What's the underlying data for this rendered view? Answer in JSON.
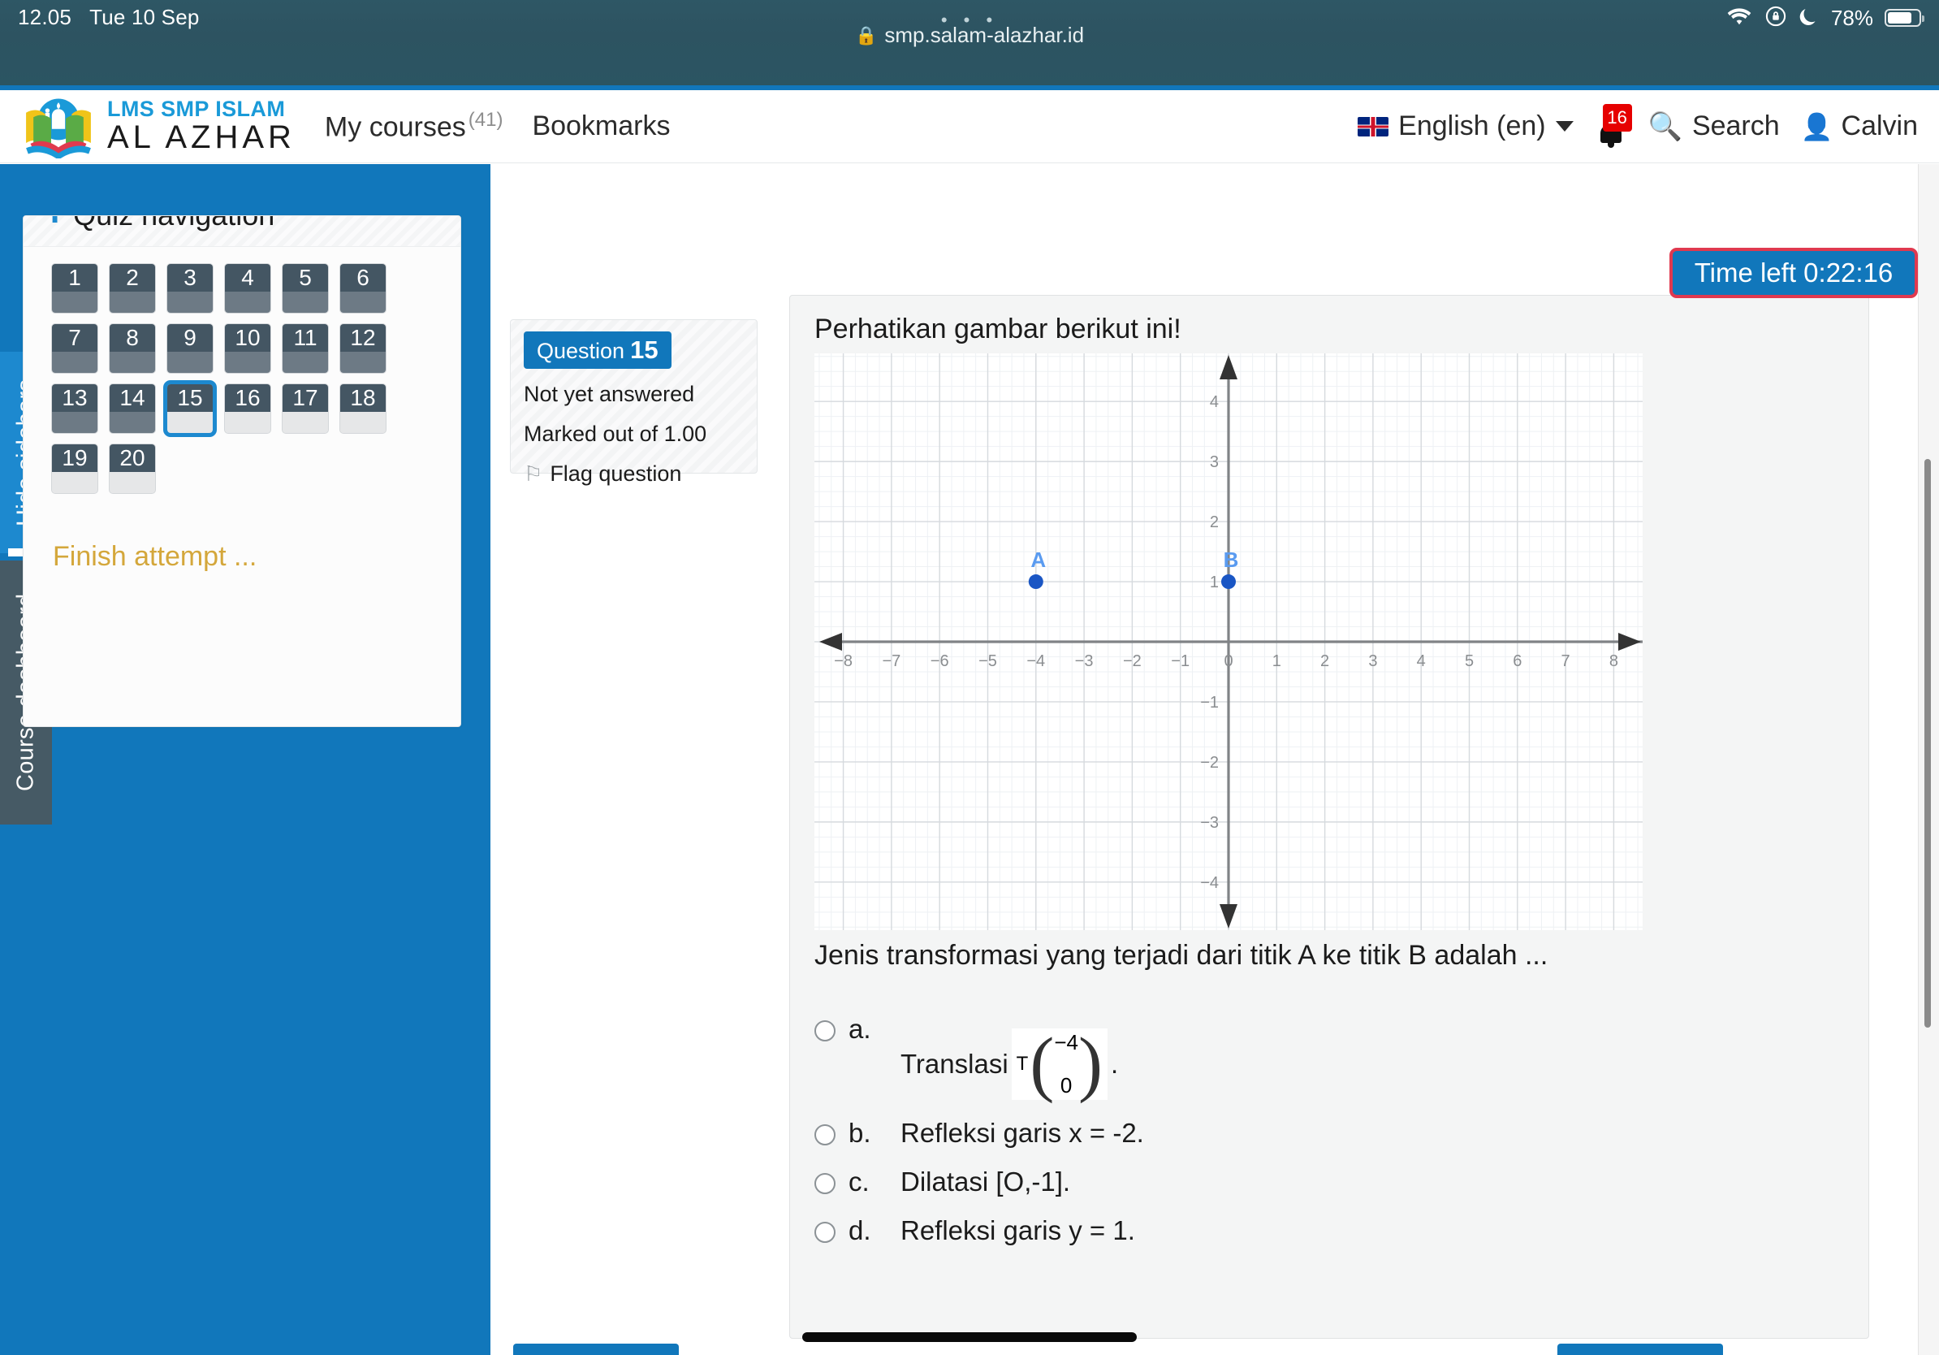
{
  "status_bar": {
    "time": "12.05",
    "date": "Tue 10 Sep",
    "battery_percent": "78%",
    "icons": [
      "wifi-icon",
      "rotation-lock-icon",
      "do-not-disturb-moon-icon",
      "battery-icon"
    ]
  },
  "browser": {
    "tab_dots": "• • •",
    "lock_icon": "🔒",
    "url": "smp.salam-alazhar.id"
  },
  "navbar": {
    "brand_top": "LMS SMP ISLAM",
    "brand_bottom": "AL AZHAR",
    "my_courses": "My courses",
    "my_courses_count": "(41)",
    "bookmarks": "Bookmarks",
    "language": "English (en)",
    "notification_count": "16",
    "search": "Search",
    "user": "Calvin"
  },
  "side_tabs": {
    "hide_sidebars": "Hide sidebars",
    "course_dashboard": "Course dashboard"
  },
  "quiz_navigation": {
    "title": "Quiz navigation",
    "questions": [
      {
        "n": "1",
        "answered": true,
        "current": false
      },
      {
        "n": "2",
        "answered": true,
        "current": false
      },
      {
        "n": "3",
        "answered": true,
        "current": false
      },
      {
        "n": "4",
        "answered": true,
        "current": false
      },
      {
        "n": "5",
        "answered": true,
        "current": false
      },
      {
        "n": "6",
        "answered": true,
        "current": false
      },
      {
        "n": "7",
        "answered": true,
        "current": false
      },
      {
        "n": "8",
        "answered": true,
        "current": false
      },
      {
        "n": "9",
        "answered": true,
        "current": false
      },
      {
        "n": "10",
        "answered": true,
        "current": false
      },
      {
        "n": "11",
        "answered": true,
        "current": false
      },
      {
        "n": "12",
        "answered": true,
        "current": false
      },
      {
        "n": "13",
        "answered": true,
        "current": false
      },
      {
        "n": "14",
        "answered": true,
        "current": false
      },
      {
        "n": "15",
        "answered": false,
        "current": true
      },
      {
        "n": "16",
        "answered": false,
        "current": false
      },
      {
        "n": "17",
        "answered": false,
        "current": false
      },
      {
        "n": "18",
        "answered": false,
        "current": false
      },
      {
        "n": "19",
        "answered": false,
        "current": false
      },
      {
        "n": "20",
        "answered": false,
        "current": false
      }
    ],
    "finish_attempt": "Finish attempt ..."
  },
  "question_meta": {
    "label": "Question",
    "number": "15",
    "state": "Not yet answered",
    "marks": "Marked out of 1.00",
    "flag": "Flag question"
  },
  "timer": {
    "label": "Time left 0:22:16"
  },
  "question": {
    "prompt": "Perhatikan gambar berikut ini!",
    "sub_prompt": "Jenis transformasi yang terjadi dari titik A ke titik B adalah ...",
    "answers": [
      {
        "letter": "a.",
        "text": "Translasi",
        "has_matrix": true,
        "matrix_symbol": "T",
        "matrix_top": "−4",
        "matrix_bottom": "0",
        "trailing": "."
      },
      {
        "letter": "b.",
        "text": "Refleksi garis x = -2.",
        "has_matrix": false
      },
      {
        "letter": "c.",
        "text": "Dilatasi [O,-1].",
        "has_matrix": false
      },
      {
        "letter": "d.",
        "text": "Refleksi garis y = 1.",
        "has_matrix": false
      }
    ]
  },
  "chart_data": {
    "type": "scatter",
    "title": "",
    "xlabel": "",
    "ylabel": "",
    "xlim": [
      -8.6,
      8.6
    ],
    "ylim": [
      -4.8,
      4.8
    ],
    "xticks": [
      -8,
      -7,
      -6,
      -5,
      -4,
      -3,
      -2,
      -1,
      0,
      1,
      2,
      3,
      4,
      5,
      6,
      7,
      8
    ],
    "yticks": [
      -4,
      -3,
      -2,
      -1,
      1,
      2,
      3,
      4
    ],
    "grid": true,
    "minor_grid": true,
    "axis_arrows": true,
    "point_color": "#1a56c4",
    "label_color": "#5a9bf0",
    "points": [
      {
        "label": "A",
        "x": -4,
        "y": 1
      },
      {
        "label": "B",
        "x": 0,
        "y": 1
      }
    ]
  },
  "bottom_bar": {
    "prev_button": "",
    "next_button": ""
  },
  "colors": {
    "brand_blue": "#1177bb",
    "accent_blue": "#1d89cf",
    "timer_border_red": "#e0394f",
    "finish_amber": "#d4a73b",
    "qbox_header": "#445663",
    "qbox_answered": "#6d7a85"
  }
}
